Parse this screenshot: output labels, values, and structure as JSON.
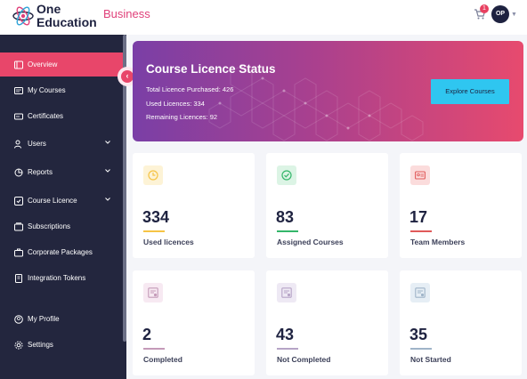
{
  "header": {
    "logo_line1": "One",
    "logo_line2": "Education",
    "brand_sub": "Business",
    "cart_count": "1",
    "avatar_initials": "OP"
  },
  "sidebar": {
    "items": [
      {
        "label": "Overview",
        "icon": "overview-icon",
        "active": true
      },
      {
        "label": "My Courses",
        "icon": "courses-icon"
      },
      {
        "label": "Certificates",
        "icon": "certificate-icon"
      },
      {
        "label": "Users",
        "icon": "users-icon",
        "expandable": true
      },
      {
        "label": "Reports",
        "icon": "reports-icon",
        "expandable": true
      },
      {
        "label": "Course Licence",
        "icon": "licence-icon",
        "expandable": true
      },
      {
        "label": "Subscriptions",
        "icon": "subscriptions-icon"
      },
      {
        "label": "Corporate Packages",
        "icon": "packages-icon"
      },
      {
        "label": "Integration Tokens",
        "icon": "token-icon"
      },
      {
        "label": "My Profile",
        "icon": "profile-icon"
      },
      {
        "label": "Settings",
        "icon": "settings-icon"
      }
    ],
    "active_color": "#e8466a"
  },
  "hero": {
    "title": "Course Licence Status",
    "total": "Total Licence Purchased: 426",
    "used": "Used Licences: 334",
    "remaining": "Remaining Licences: 92",
    "button_label": "Explore Courses"
  },
  "cards": [
    {
      "value": "334",
      "label": "Used licences",
      "icon": "clock-icon",
      "color": "#f6c445",
      "bg": "#fdf3d6"
    },
    {
      "value": "83",
      "label": "Assigned Courses",
      "icon": "check-circle-icon",
      "color": "#34b66a",
      "bg": "#dcf4e5"
    },
    {
      "value": "17",
      "label": "Team Members",
      "icon": "id-card-icon",
      "color": "#e05a5a",
      "bg": "#fbdcdc"
    },
    {
      "value": "2",
      "label": "Completed",
      "icon": "certificate-icon",
      "color": "#c49ab8",
      "bg": "#f7e9f2"
    },
    {
      "value": "43",
      "label": "Not Completed",
      "icon": "certificate-icon",
      "color": "#b6a4c6",
      "bg": "#eee9f4"
    },
    {
      "value": "35",
      "label": "Not Started",
      "icon": "certificate-icon",
      "color": "#9fb4c8",
      "bg": "#e6eef5"
    }
  ]
}
